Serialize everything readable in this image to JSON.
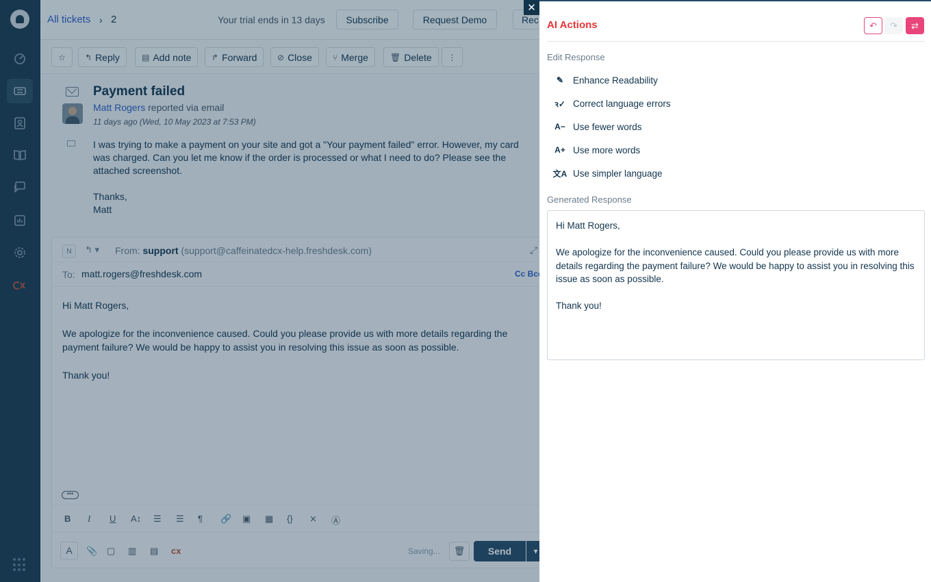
{
  "topbar": {
    "breadcrumb": "All tickets",
    "ticket_number": "2",
    "trial_text": "Your trial ends in 13 days",
    "subscribe_label": "Subscribe",
    "request_demo_label": "Request Demo",
    "truncated_label": "Rec"
  },
  "actionbar": {
    "reply": "Reply",
    "add_note": "Add note",
    "forward": "Forward",
    "close": "Close",
    "merge": "Merge",
    "delete": "Delete"
  },
  "ticket": {
    "title": "Payment failed",
    "reporter_name": "Matt Rogers",
    "reported_via": "reported via email",
    "timestamp": "11 days ago (Wed, 10 May 2023 at 7:53 PM)",
    "body": [
      "I was trying to make a payment on your site and got a \"Your payment failed\" error. However, my card was charged. Can you let me know if the order is processed or what I need to do? Please see the attached screenshot.",
      "Thanks,",
      "Matt"
    ]
  },
  "editor": {
    "n_badge": "N",
    "from_label": "From:",
    "from_name": "support",
    "from_email": "(support@caffeinatedcx-help.freshdesk.com)",
    "to_label": "To:",
    "to_value": "matt.rogers@freshdesk.com",
    "cc_bcc": "Cc  Bcc",
    "body": [
      "Hi Matt Rogers,",
      "We apologize for the inconvenience caused. Could you please provide us with more details regarding the payment failure? We would be happy to assist you in resolving this issue as soon as possible.",
      "Thank you!"
    ],
    "saving_text": "Saving...",
    "send_label": "Send"
  },
  "panel": {
    "title": "AI Actions",
    "edit_section": "Edit Response",
    "actions": [
      {
        "label": "Enhance Readability",
        "icon": "pencil-icon"
      },
      {
        "label": "Correct language errors",
        "icon": "spellcheck-icon"
      },
      {
        "label": "Use fewer words",
        "icon": "text-decrease-icon"
      },
      {
        "label": "Use more words",
        "icon": "text-increase-icon"
      },
      {
        "label": "Use simpler language",
        "icon": "translate-icon"
      }
    ],
    "generated_section": "Generated Response",
    "generated": [
      "Hi Matt Rogers,",
      "We apologize for the inconvenience caused. Could you please provide us with more details regarding the payment failure? We would be happy to assist you in resolving this issue as soon as possible.",
      "Thank you!"
    ]
  },
  "colors": {
    "sidebar": "#1b3a4f",
    "panel_title": "#e43538",
    "accent_pink": "#e8467a",
    "link_blue": "#2c5cc5",
    "send_button": "#264966"
  }
}
